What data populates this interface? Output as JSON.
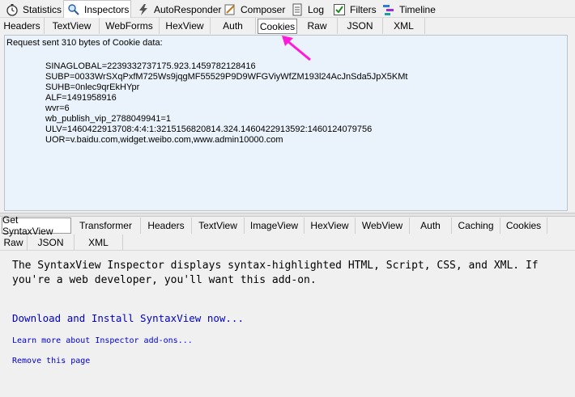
{
  "main_tabs": [
    {
      "label": "Statistics",
      "icon": "stopwatch-icon"
    },
    {
      "label": "Inspectors",
      "icon": "inspector-icon"
    },
    {
      "label": "AutoResponder",
      "icon": "lightning-icon"
    },
    {
      "label": "Composer",
      "icon": "pencil-icon"
    },
    {
      "label": "Log",
      "icon": "log-icon"
    },
    {
      "label": "Filters",
      "icon": "checkbox-icon"
    },
    {
      "label": "Timeline",
      "icon": "timeline-icon"
    }
  ],
  "request_tabs": [
    "Headers",
    "TextView",
    "WebForms",
    "HexView",
    "Auth",
    "Cookies",
    "Raw",
    "JSON",
    "XML"
  ],
  "request_pane": {
    "header": "Request sent 310 bytes of Cookie data:",
    "cookies": [
      "SINAGLOBAL=2239332737175.923.1459782128416",
      "SUBP=0033WrSXqPxfM725Ws9jqgMF55529P9D9WFGViyWfZM193l24AcJnSda5JpX5KMt",
      "SUHB=0nlec9qrEkHYpr",
      "ALF=1491958916",
      "wvr=6",
      "wb_publish_vip_2788049941=1",
      "ULV=1460422913708:4:4:1:3215156820814.324.1460422913592:1460124079756",
      "UOR=v.baidu.com,widget.weibo.com,www.admin10000.com"
    ]
  },
  "response_tabs_row1": [
    "Get SyntaxView",
    "Transformer",
    "Headers",
    "TextView",
    "ImageView",
    "HexView",
    "WebView",
    "Auth",
    "Caching",
    "Cookies"
  ],
  "response_tabs_row2": [
    "Raw",
    "JSON",
    "XML"
  ],
  "response_pane": {
    "description": "The SyntaxView Inspector displays syntax-highlighted HTML, Script, CSS, and XML. If you're a web developer, you'll want this add-on.",
    "download_link": "Download and Install SyntaxView now...",
    "learn_link": "Learn more about Inspector add-ons...",
    "remove_link": "Remove this page"
  },
  "colors": {
    "link": "#0000cc",
    "pane_bg": "#eaf3fb",
    "arrow": "#ff1ad9"
  }
}
